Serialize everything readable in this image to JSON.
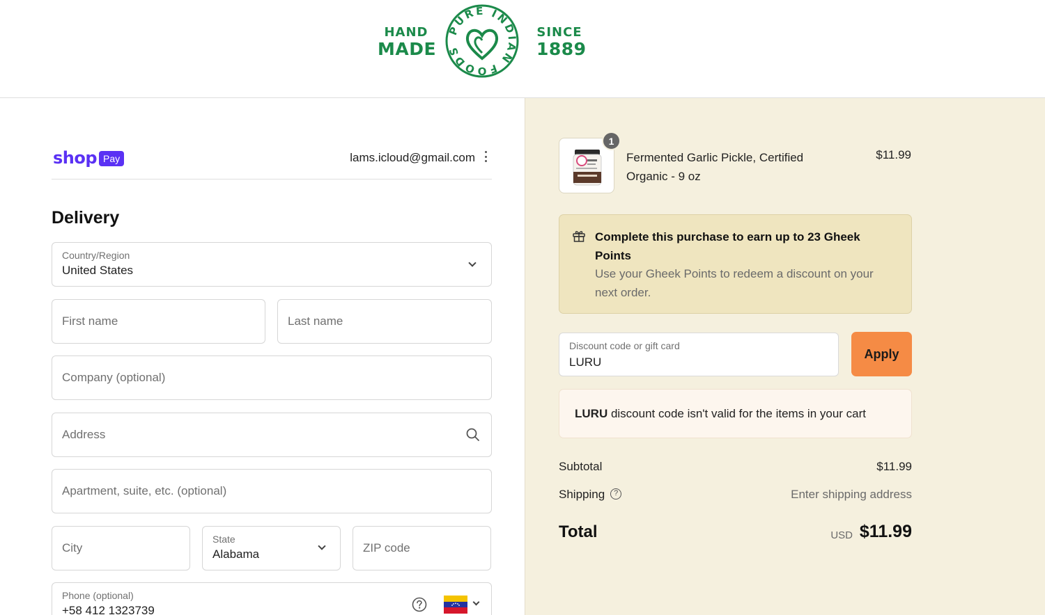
{
  "header": {
    "brand_left_top": "HAND",
    "brand_left_bottom": "MADE",
    "brand_right_top": "SINCE",
    "brand_right_bottom": "1889",
    "seal_text": "PURE INDIAN FOODS"
  },
  "account": {
    "shop_word": "shop",
    "pay_word": "Pay",
    "email": "lams.icloud@gmail.com"
  },
  "delivery": {
    "title": "Delivery",
    "country": {
      "label": "Country/Region",
      "value": "United States"
    },
    "first_name": {
      "placeholder": "First name"
    },
    "last_name": {
      "placeholder": "Last name"
    },
    "company": {
      "placeholder": "Company (optional)"
    },
    "address": {
      "placeholder": "Address"
    },
    "apartment": {
      "placeholder": "Apartment, suite, etc. (optional)"
    },
    "city": {
      "placeholder": "City"
    },
    "state": {
      "label": "State",
      "value": "Alabama"
    },
    "zip": {
      "placeholder": "ZIP code"
    },
    "phone": {
      "label": "Phone (optional)",
      "value": "+58 412 1323739"
    }
  },
  "summary": {
    "item": {
      "quantity": "1",
      "name": "Fermented Garlic Pickle, Certified Organic - 9 oz",
      "price": "$11.99"
    },
    "points": {
      "title": "Complete this purchase to earn up to 23 Gheek Points",
      "body": "Use your Gheek Points to redeem a discount on your next order."
    },
    "discount": {
      "label": "Discount code or gift card",
      "value": "LURU",
      "apply_label": "Apply"
    },
    "error": {
      "code": "LURU",
      "message": " discount code isn't valid for the items in your cart"
    },
    "subtotal": {
      "label": "Subtotal",
      "value": "$11.99"
    },
    "shipping": {
      "label": "Shipping",
      "value": "Enter shipping address"
    },
    "total": {
      "label": "Total",
      "currency": "USD",
      "value": "$11.99"
    }
  },
  "colors": {
    "brand_green": "#1b8a4a",
    "shop_purple": "#5a31f4",
    "apply_orange": "#f58b45",
    "summary_bg": "#f5f0de",
    "points_bg": "#efe5bf"
  }
}
